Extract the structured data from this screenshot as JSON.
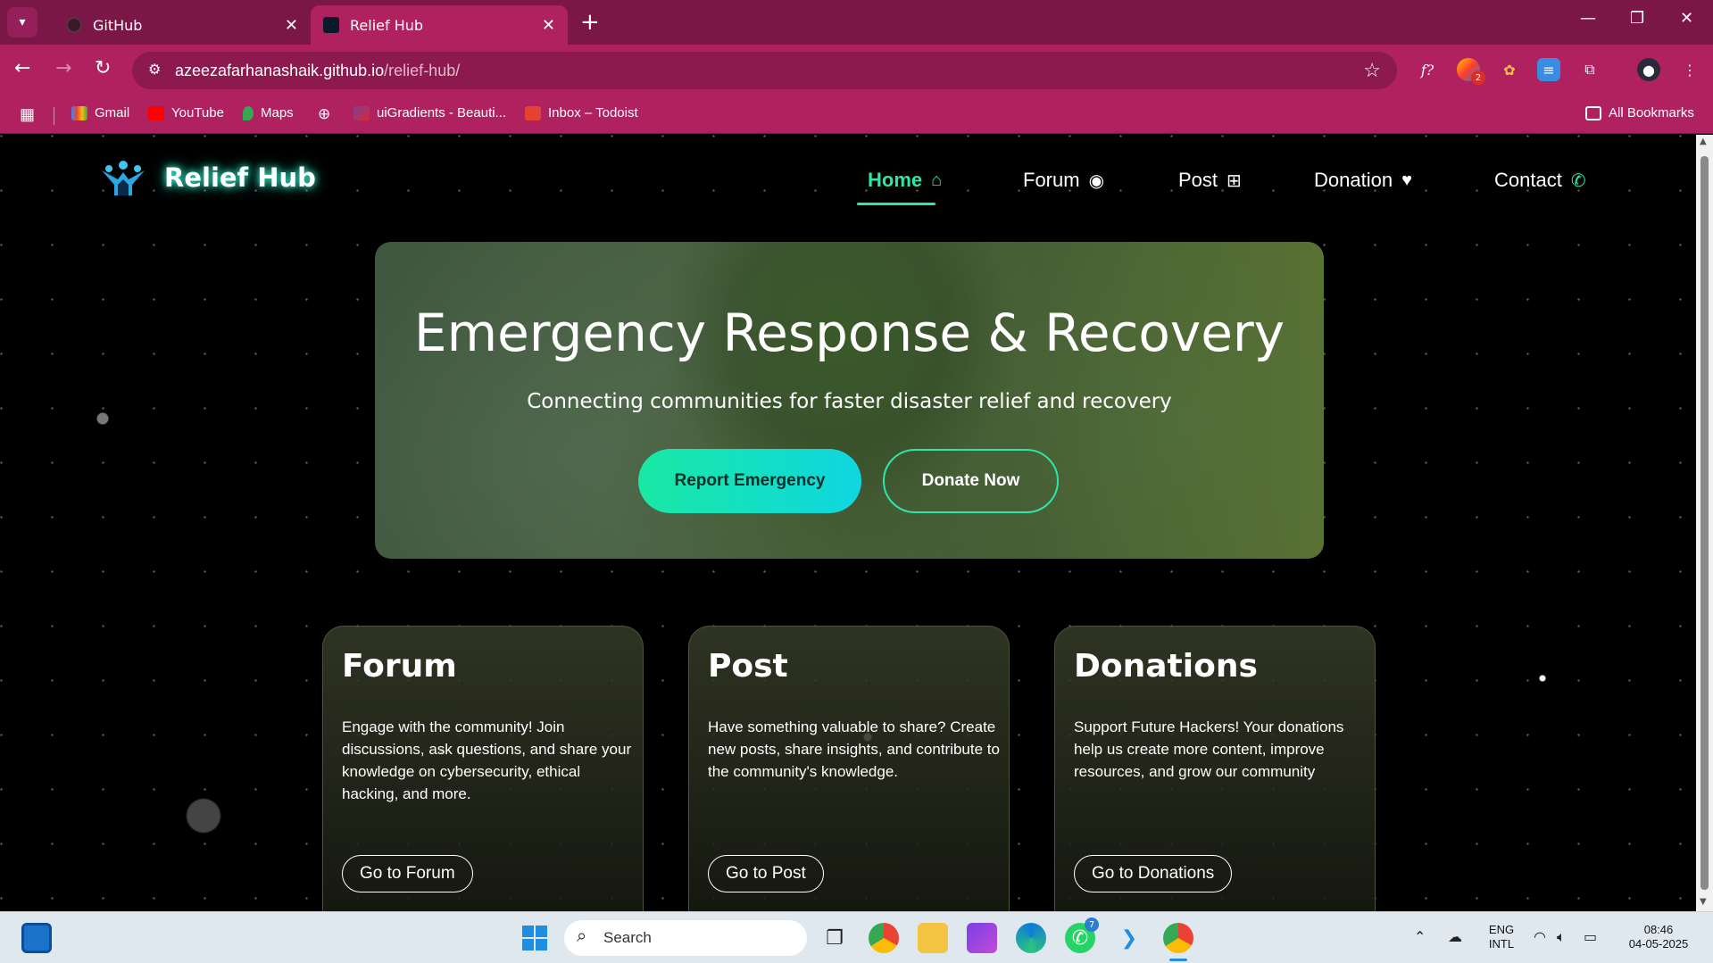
{
  "browser": {
    "tabs": [
      {
        "title": "GitHub",
        "active": false
      },
      {
        "title": "Relief Hub",
        "active": true
      }
    ],
    "url_host": "azeezafarhanashaik.github.io",
    "url_path": "/relief-hub/",
    "bookmarks": [
      {
        "label": "Gmail",
        "icon": "gmail-icon"
      },
      {
        "label": "YouTube",
        "icon": "youtube-icon"
      },
      {
        "label": "Maps",
        "icon": "maps-icon"
      },
      {
        "label": "uiGradients - Beauti...",
        "icon": "uigradients-icon"
      },
      {
        "label": "Inbox – Todoist",
        "icon": "todoist-icon"
      }
    ],
    "all_bookmarks": "All Bookmarks",
    "extension_badge": "2",
    "accent": "#b0215f"
  },
  "site": {
    "logo_text": "Relief Hub",
    "nav": [
      {
        "label": "Home",
        "icon": "home-icon",
        "active": true
      },
      {
        "label": "Forum",
        "icon": "chat-icon",
        "active": false
      },
      {
        "label": "Post",
        "icon": "add-post-icon",
        "active": false
      },
      {
        "label": "Donation",
        "icon": "donate-icon",
        "active": false
      },
      {
        "label": "Contact",
        "icon": "phone-icon",
        "active": false
      }
    ],
    "hero": {
      "title": "Emergency Response & Recovery",
      "subtitle": "Connecting communities for faster disaster relief and recovery",
      "primary_button": "Report Emergency",
      "secondary_button": "Donate Now"
    },
    "cards": [
      {
        "title": "Forum",
        "text": "Engage with the community! Join discussions, ask questions, and share your knowledge on cybersecurity, ethical hacking, and more.",
        "button": "Go to Forum"
      },
      {
        "title": "Post",
        "text": "Have something valuable to share? Create new posts, share insights, and contribute to the community's knowledge.",
        "button": "Go to Post"
      },
      {
        "title": "Donations",
        "text": "Support Future Hackers! Your donations help us create more content, improve resources, and grow our community",
        "button": "Go to Donations"
      }
    ],
    "accent": "#2ee6a9"
  },
  "taskbar": {
    "search_placeholder": "Search",
    "whatsapp_badge": "7",
    "lang_line1": "ENG",
    "lang_line2": "INTL",
    "time": "08:46",
    "date": "04-05-2025"
  }
}
